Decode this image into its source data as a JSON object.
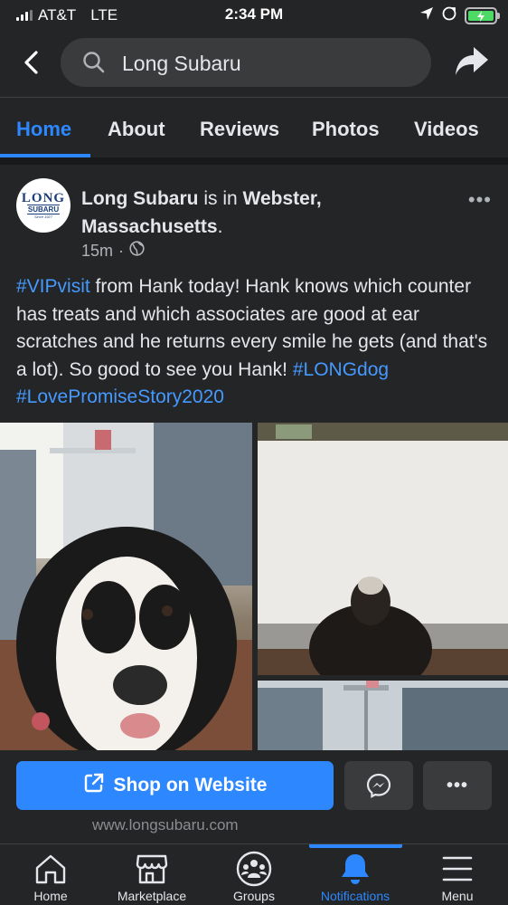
{
  "status_bar": {
    "carrier": "AT&T",
    "network": "LTE",
    "time": "2:34 PM"
  },
  "search": {
    "query": "Long Subaru"
  },
  "tabs": [
    {
      "label": "Home",
      "active": true
    },
    {
      "label": "About"
    },
    {
      "label": "Reviews"
    },
    {
      "label": "Photos"
    },
    {
      "label": "Videos"
    }
  ],
  "post": {
    "avatar": {
      "line1": "LONG",
      "line2": "SUBARU",
      "line3": "Since 1927"
    },
    "page_name": "Long Subaru",
    "is_in_text": " is in ",
    "location": "Webster, Massachusetts",
    "location_suffix": ".",
    "time_ago": "15m",
    "meta_sep": "·",
    "body": {
      "tag1": "#VIPvisit",
      "text": " from Hank today! Hank knows which counter has treats and which associates are good at ear scratches and he returns every smile he gets (and that's a lot). So good to see you Hank! ",
      "tag2": "#LONGdog",
      "space": " ",
      "tag3": "#LovePromiseStory2020"
    }
  },
  "actions": {
    "shop_label": "Shop on Website",
    "more_label": "•••",
    "website": "www.longsubaru.com"
  },
  "bottom_nav": [
    {
      "label": "Home"
    },
    {
      "label": "Marketplace"
    },
    {
      "label": "Groups"
    },
    {
      "label": "Notifications",
      "active": true
    },
    {
      "label": "Menu"
    }
  ],
  "colors": {
    "background": "#242526",
    "accent": "#2d88ff",
    "hashtag": "#4599ff"
  }
}
